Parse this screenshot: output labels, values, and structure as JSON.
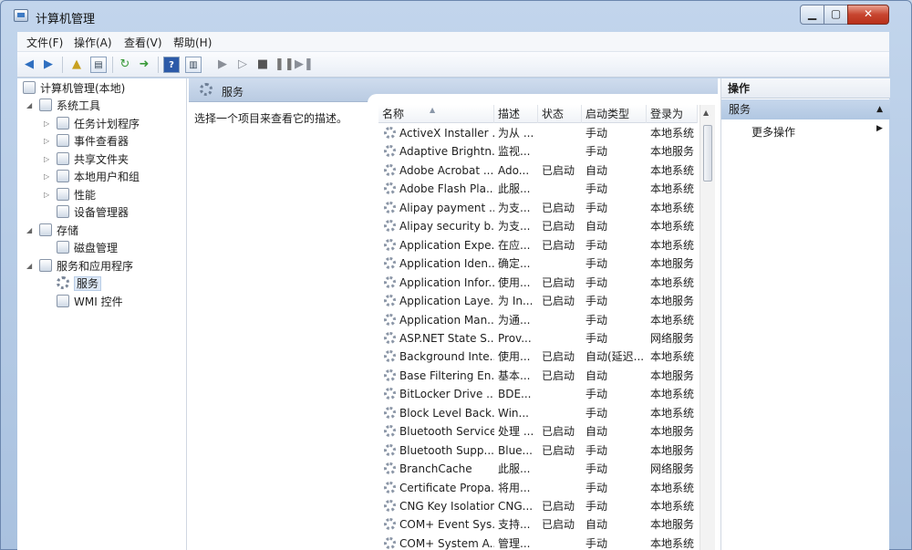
{
  "window": {
    "title": "计算机管理",
    "min": "▁",
    "max": "▢",
    "close": "✕"
  },
  "menu": [
    "文件(F)",
    "操作(A)",
    "查看(V)",
    "帮助(H)"
  ],
  "tree": {
    "root": "计算机管理(本地)",
    "system_tools": "系统工具",
    "task_scheduler": "任务计划程序",
    "event_viewer": "事件查看器",
    "shared_folders": "共享文件夹",
    "local_users": "本地用户和组",
    "performance": "性能",
    "device_manager": "设备管理器",
    "storage": "存储",
    "disk_management": "磁盘管理",
    "services_apps": "服务和应用程序",
    "services": "服务",
    "wmi": "WMI 控件"
  },
  "center": {
    "title": "服务",
    "description": "选择一个项目来查看它的描述。",
    "columns": {
      "name": "名称",
      "desc": "描述",
      "state": "状态",
      "startup": "启动类型",
      "logon": "登录为"
    },
    "rows": [
      {
        "name": "ActiveX Installer ...",
        "desc": "为从 ...",
        "state": "",
        "startup": "手动",
        "logon": "本地系统"
      },
      {
        "name": "Adaptive Brightn...",
        "desc": "监视...",
        "state": "",
        "startup": "手动",
        "logon": "本地服务"
      },
      {
        "name": "Adobe Acrobat ...",
        "desc": "Ado...",
        "state": "已启动",
        "startup": "自动",
        "logon": "本地系统"
      },
      {
        "name": "Adobe Flash Pla...",
        "desc": "此服...",
        "state": "",
        "startup": "手动",
        "logon": "本地系统"
      },
      {
        "name": "Alipay payment ...",
        "desc": "为支...",
        "state": "已启动",
        "startup": "手动",
        "logon": "本地系统"
      },
      {
        "name": "Alipay security b...",
        "desc": "为支...",
        "state": "已启动",
        "startup": "自动",
        "logon": "本地系统"
      },
      {
        "name": "Application Expe...",
        "desc": "在应...",
        "state": "已启动",
        "startup": "手动",
        "logon": "本地系统"
      },
      {
        "name": "Application Iden...",
        "desc": "确定...",
        "state": "",
        "startup": "手动",
        "logon": "本地服务"
      },
      {
        "name": "Application Infor...",
        "desc": "使用...",
        "state": "已启动",
        "startup": "手动",
        "logon": "本地系统"
      },
      {
        "name": "Application Laye...",
        "desc": "为 In...",
        "state": "已启动",
        "startup": "手动",
        "logon": "本地服务"
      },
      {
        "name": "Application Man...",
        "desc": "为通...",
        "state": "",
        "startup": "手动",
        "logon": "本地系统"
      },
      {
        "name": "ASP.NET State S...",
        "desc": "Prov...",
        "state": "",
        "startup": "手动",
        "logon": "网络服务"
      },
      {
        "name": "Background Inte...",
        "desc": "使用...",
        "state": "已启动",
        "startup": "自动(延迟...",
        "logon": "本地系统"
      },
      {
        "name": "Base Filtering En...",
        "desc": "基本...",
        "state": "已启动",
        "startup": "自动",
        "logon": "本地服务"
      },
      {
        "name": "BitLocker Drive ...",
        "desc": "BDE...",
        "state": "",
        "startup": "手动",
        "logon": "本地系统"
      },
      {
        "name": "Block Level Back...",
        "desc": "Win...",
        "state": "",
        "startup": "手动",
        "logon": "本地系统"
      },
      {
        "name": "Bluetooth Service",
        "desc": "处理 ...",
        "state": "已启动",
        "startup": "自动",
        "logon": "本地服务"
      },
      {
        "name": "Bluetooth Supp...",
        "desc": "Blue...",
        "state": "已启动",
        "startup": "手动",
        "logon": "本地服务"
      },
      {
        "name": "BranchCache",
        "desc": "此服...",
        "state": "",
        "startup": "手动",
        "logon": "网络服务"
      },
      {
        "name": "Certificate Propa...",
        "desc": "将用...",
        "state": "",
        "startup": "手动",
        "logon": "本地系统"
      },
      {
        "name": "CNG Key Isolation",
        "desc": "CNG...",
        "state": "已启动",
        "startup": "手动",
        "logon": "本地系统"
      },
      {
        "name": "COM+ Event Sys...",
        "desc": "支持...",
        "state": "已启动",
        "startup": "自动",
        "logon": "本地服务"
      },
      {
        "name": "COM+ System A...",
        "desc": "管理...",
        "state": "",
        "startup": "手动",
        "logon": "本地系统"
      }
    ]
  },
  "actions": {
    "title": "操作",
    "section": "服务",
    "more": "更多操作"
  },
  "colors": {
    "accent": "#3f7bc4",
    "pane_header": "#c6d7ec"
  }
}
